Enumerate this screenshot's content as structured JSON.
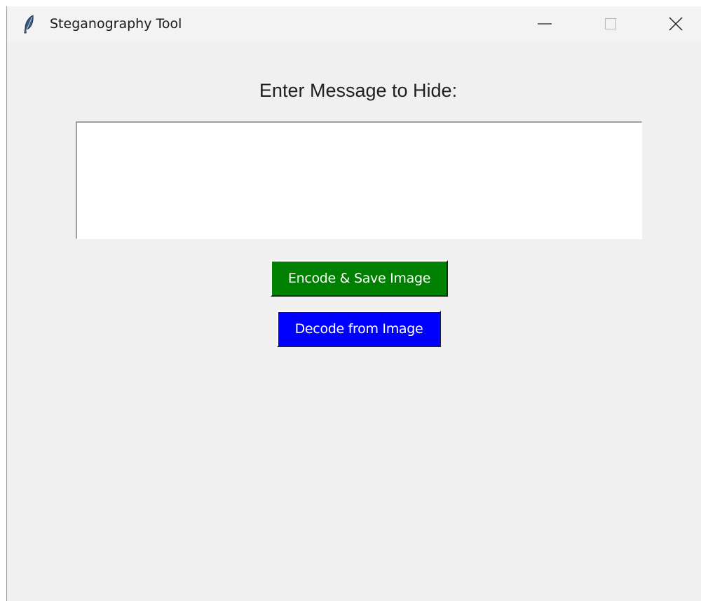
{
  "window": {
    "title": "Steganography Tool",
    "icon": "feather-icon",
    "controls": [
      "minimize-icon",
      "maximize-icon",
      "close-icon"
    ]
  },
  "main": {
    "prompt_label": "Enter Message to Hide:",
    "message_value": "",
    "encode_button": "Encode & Save Image",
    "decode_button": "Decode from Image"
  },
  "colors": {
    "encode_bg": "#008000",
    "decode_bg": "#0000ff",
    "window_bg": "#f0f0f0",
    "text_area_bg": "#ffffff"
  }
}
